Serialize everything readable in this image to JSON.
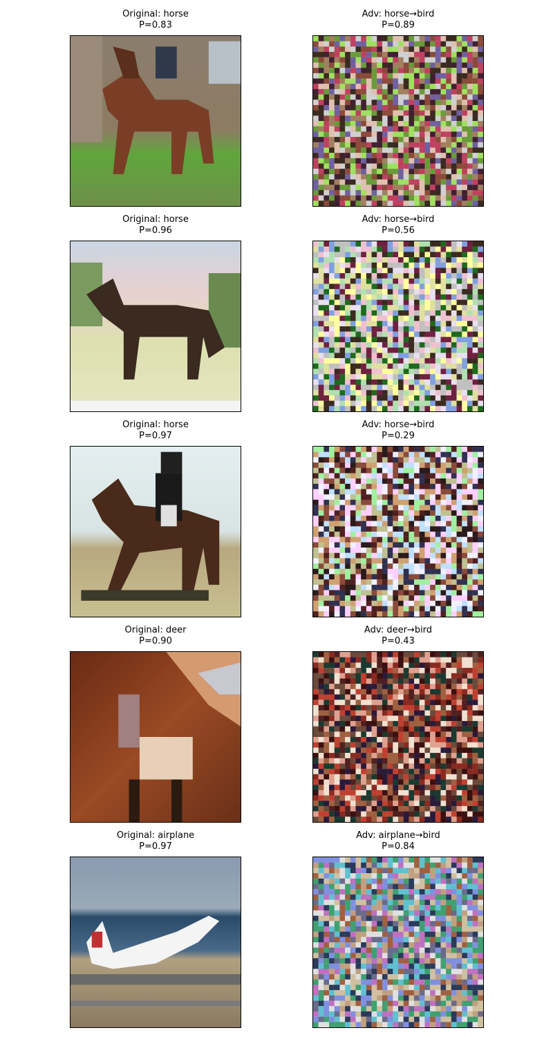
{
  "panels": [
    {
      "orig_title": "Original: horse",
      "orig_p": "P=0.83",
      "adv_title": "Adv: horse→bird",
      "adv_p": "P=0.89",
      "orig_icon": "horse-image",
      "adv_icon": "adversarial-horse-image"
    },
    {
      "orig_title": "Original: horse",
      "orig_p": "P=0.96",
      "adv_title": "Adv: horse→bird",
      "adv_p": "P=0.56",
      "orig_icon": "horse-image",
      "adv_icon": "adversarial-horse-image"
    },
    {
      "orig_title": "Original: horse",
      "orig_p": "P=0.97",
      "adv_title": "Adv: horse→bird",
      "adv_p": "P=0.29",
      "orig_icon": "horse-rider-image",
      "adv_icon": "adversarial-horse-rider-image"
    },
    {
      "orig_title": "Original: deer",
      "orig_p": "P=0.90",
      "adv_title": "Adv: deer→bird",
      "adv_p": "P=0.43",
      "orig_icon": "deer-image",
      "adv_icon": "adversarial-deer-image"
    },
    {
      "orig_title": "Original: airplane",
      "orig_p": "P=0.97",
      "adv_title": "Adv: airplane→bird",
      "adv_p": "P=0.84",
      "orig_icon": "airplane-image",
      "adv_icon": "adversarial-airplane-image"
    }
  ]
}
